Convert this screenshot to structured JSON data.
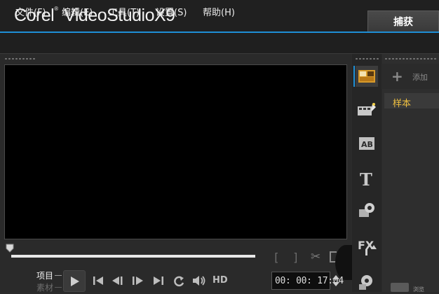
{
  "app": {
    "brand_corel": "Corel",
    "brand_reg": "®",
    "brand_product": "VideoStudio",
    "brand_version": "X9"
  },
  "tabs": {
    "capture": "捕获"
  },
  "menu": {
    "items": [
      {
        "label": "文件(F)"
      },
      {
        "label": "编辑(E)"
      },
      {
        "label": "工具(T)"
      },
      {
        "label": "设置(S)"
      },
      {
        "label": "帮助(H)"
      }
    ]
  },
  "player": {
    "mark_in": "[",
    "mark_out": "]",
    "project_label": "项目",
    "clip_label": "素材",
    "hd_label": "HD",
    "timecode": "00: 00: 17:04"
  },
  "library": {
    "add_label": "添加",
    "sample_folder": "样本",
    "browse_label": "浏览"
  },
  "icons": [
    "media-library-icon",
    "instant-project-icon",
    "transition-icon",
    "title-icon",
    "graphics-icon",
    "filter-icon",
    "path-icon"
  ],
  "colors": {
    "accent": "#1e8fd6",
    "sample_text": "#f0c040"
  }
}
